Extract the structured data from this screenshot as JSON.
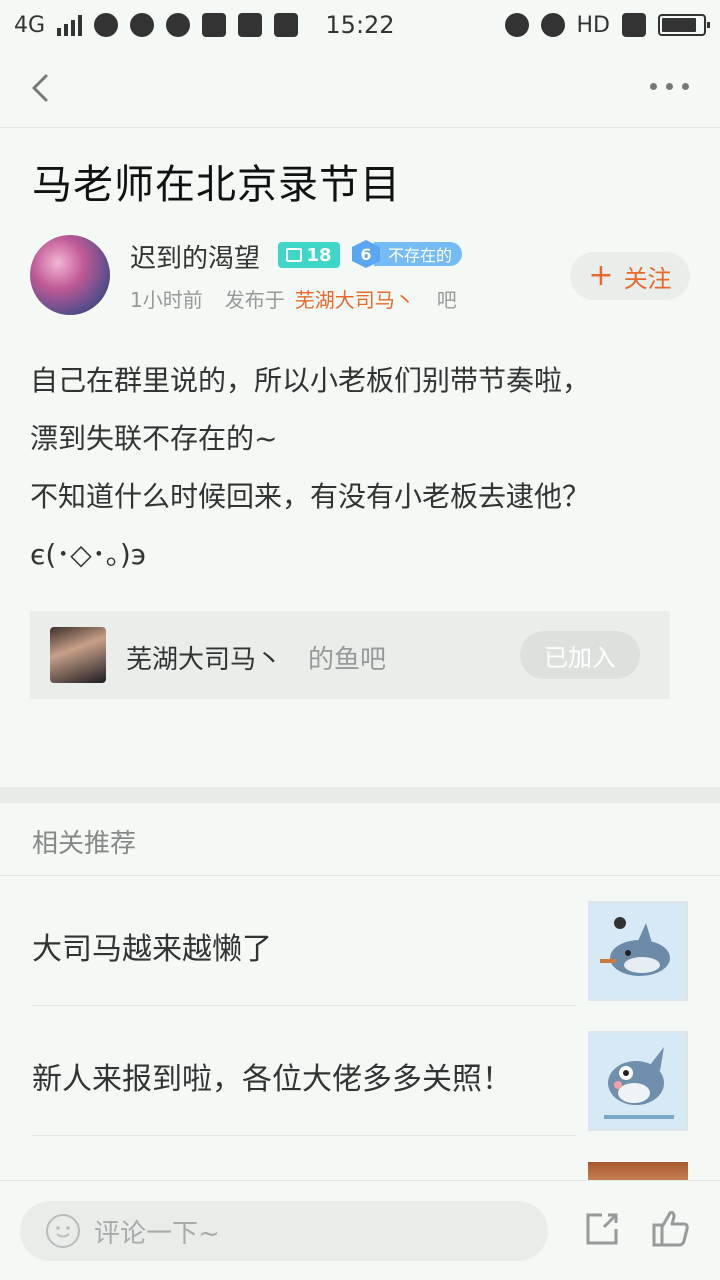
{
  "status_bar": {
    "network": "4G",
    "time": "15:22",
    "hd_label": "HD"
  },
  "nav": {
    "back_icon": "chevron-left-icon",
    "more_icon": "more-dots-icon"
  },
  "post": {
    "title": "马老师在北京录节目",
    "author": {
      "name": "迟到的渴望",
      "level": "18",
      "title_badge_num": "6",
      "title_badge_text": "不存在的"
    },
    "meta": {
      "time_ago": "1小时前",
      "published_in_label": "发布于",
      "forum_name": "芜湖大司马丶",
      "forum_suffix": "吧"
    },
    "follow_label": "关注",
    "follow_plus": "+",
    "body_lines": [
      "自己在群里说的，所以小老板们别带节奏啦，",
      "漂到失联不存在的~",
      "不知道什么时候回来，有没有小老板去逮他？",
      "є(･◇･｡)э"
    ]
  },
  "forum_card": {
    "name": "芜湖大司马丶",
    "suffix": "的鱼吧",
    "joined_label": "已加入"
  },
  "recommend": {
    "header": "相关推荐",
    "items": [
      {
        "title": "大司马越来越懒了"
      },
      {
        "title": "新人来报到啦，各位大佬多多关照！"
      }
    ]
  },
  "bottom_bar": {
    "comment_placeholder": "评论一下~",
    "share_icon": "share-icon",
    "like_icon": "thumbs-up-icon"
  },
  "colors": {
    "accent": "#e8692b",
    "background": "#f4f9f5",
    "level_badge": "#3fd6c8",
    "title_badge": "#75bbf6"
  }
}
